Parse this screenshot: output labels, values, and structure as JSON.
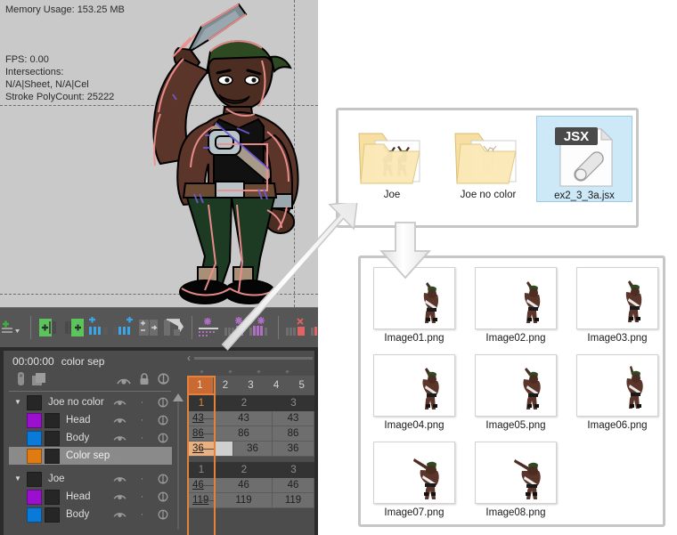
{
  "app": {
    "viewer": {
      "stats": [
        "Memory Usage: 153.25 MB",
        "FPS: 0.00",
        "Intersections:",
        "N/A|Sheet, N/A|Cel",
        "Stroke PolyCount: 25222"
      ],
      "memory_label": "Memory Usage: 153.25 MB",
      "fps_label": "FPS: 0.00",
      "intersections_label": "Intersections:",
      "intersections_value": "N/A|Sheet, N/A|Cel",
      "polycount_label": "Stroke PolyCount: 25222"
    },
    "toolbar": {
      "items": [
        {
          "name": "new-vector-level-menu-icon",
          "glyph": "plus-green-lines"
        },
        {
          "name": "insert-cell-left-icon",
          "glyph": "green-insert-left"
        },
        {
          "name": "insert-cell-right-icon",
          "glyph": "green-insert-right"
        },
        {
          "name": "add-frames-before-icon",
          "glyph": "blue-add-before"
        },
        {
          "name": "add-frames-after-icon",
          "glyph": "blue-add-after"
        },
        {
          "name": "duplicate-frame-icon",
          "glyph": "gray-duplicate"
        },
        {
          "name": "shift-cells-icon",
          "glyph": "gray-shift"
        },
        {
          "name": "collapse-column-icon",
          "glyph": "purple-collapse"
        },
        {
          "name": "reframe-1s-icon",
          "glyph": "purple-reframe-1"
        },
        {
          "name": "reframe-2s-icon",
          "glyph": "purple-reframe-2"
        },
        {
          "name": "remove-cells-icon",
          "glyph": "red-remove-1"
        },
        {
          "name": "delete-cells-icon",
          "glyph": "red-remove-2"
        }
      ]
    },
    "xsheet": {
      "timecode": "00:00:00",
      "scene_name": "color sep",
      "header_icons": [
        {
          "name": "thumbnail-toggle-icon"
        },
        {
          "name": "camera-stand-toggle-icon"
        },
        {
          "name": "preview-visible-icon"
        },
        {
          "name": "lock-icon"
        },
        {
          "name": "onion-skin-icon"
        }
      ],
      "groups": [
        {
          "name": "Joe no color",
          "expanded": true,
          "chip": "",
          "group_frames": [
            "1",
            "2",
            "3"
          ],
          "layers": [
            {
              "name": "Head",
              "chip": "#9b10cf",
              "cells": [
                "43",
                "43",
                "43"
              ],
              "selected": false
            },
            {
              "name": "Body",
              "chip": "#0a7ad8",
              "cells": [
                "86",
                "86",
                "86"
              ],
              "selected": false
            },
            {
              "name": "Color sep",
              "chip": "#e07b12",
              "cells": [
                "36",
                "36",
                "36"
              ],
              "selected": true
            }
          ]
        },
        {
          "name": "Joe",
          "expanded": true,
          "chip": "",
          "group_frames": [
            "1",
            "2",
            "3"
          ],
          "layers": [
            {
              "name": "Head",
              "chip": "#9b10cf",
              "cells": [
                "46",
                "46",
                "46"
              ],
              "selected": false
            },
            {
              "name": "Body",
              "chip": "#0a7ad8",
              "cells": [
                "119",
                "119",
                "119"
              ],
              "selected": false
            }
          ]
        }
      ],
      "frame_numbers": [
        "1",
        "2",
        "3",
        "4",
        "5"
      ],
      "current_frame": "1",
      "accent_color": "#e4813a"
    }
  },
  "explorer_top": {
    "items": [
      {
        "label": "Joe",
        "type": "folder",
        "selected": false,
        "name": "folder-joe"
      },
      {
        "label": "Joe no color",
        "type": "folder",
        "selected": false,
        "name": "folder-joe-no-color"
      },
      {
        "label": "ex2_3_3a.jsx",
        "type": "jsx-file",
        "badge": "JSX",
        "selected": true,
        "name": "file-ex2-3-3a-jsx"
      }
    ]
  },
  "explorer_bottom": {
    "items": [
      {
        "label": "Image01.png",
        "name": "thumb-image01"
      },
      {
        "label": "Image02.png",
        "name": "thumb-image02"
      },
      {
        "label": "Image03.png",
        "name": "thumb-image03"
      },
      {
        "label": "Image04.png",
        "name": "thumb-image04"
      },
      {
        "label": "Image05.png",
        "name": "thumb-image05"
      },
      {
        "label": "Image06.png",
        "name": "thumb-image06"
      },
      {
        "label": "Image07.png",
        "name": "thumb-image07"
      },
      {
        "label": "Image08.png",
        "name": "thumb-image08"
      }
    ]
  },
  "annotations": {
    "arrow_diagonal": "points-from-xsheet-to-canvas",
    "arrow_down": "points-from-folders-to-images"
  },
  "colors": {
    "viewer_bg": "#c9c9c9",
    "panel_bg": "#4c4c4c",
    "toolbar_bg": "#565656",
    "cell_bg": "#6e6e6e",
    "accent": "#e4813a",
    "selection_blue": "#cde8f7"
  }
}
